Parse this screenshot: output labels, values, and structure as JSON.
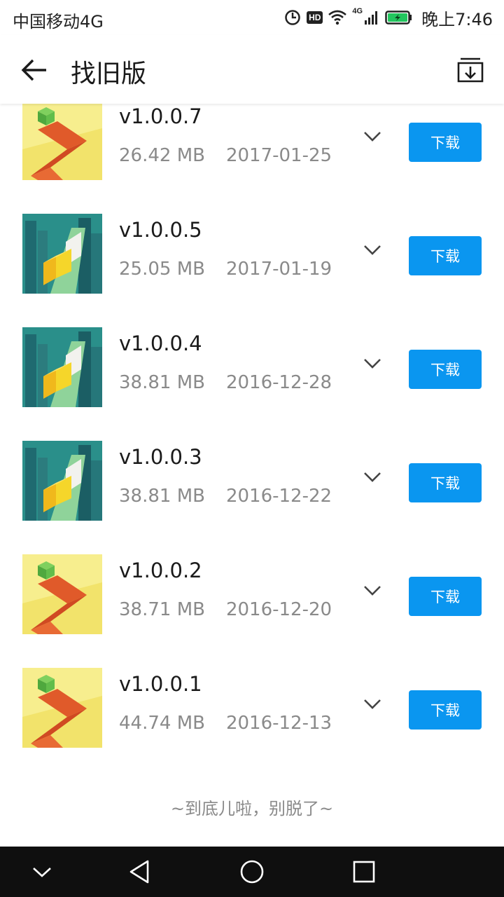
{
  "status_bar": {
    "carrier": "中国移动4G",
    "hd": "HD",
    "network": "4G",
    "time": "晚上7:46",
    "battery_color": "#22c55e"
  },
  "app_bar": {
    "title": "找旧版",
    "back_icon": "arrow-left-icon",
    "download_manager_icon": "download-tray-icon"
  },
  "versions": [
    {
      "version": "v1.0.0.7",
      "size": "26.42 MB",
      "date": "2017-01-25",
      "icon_theme": "yellow-zigzag",
      "download_label": "下载"
    },
    {
      "version": "v1.0.0.5",
      "size": "25.05 MB",
      "date": "2017-01-19",
      "icon_theme": "city-tower",
      "download_label": "下载"
    },
    {
      "version": "v1.0.0.4",
      "size": "38.81 MB",
      "date": "2016-12-28",
      "icon_theme": "city-tower",
      "download_label": "下载"
    },
    {
      "version": "v1.0.0.3",
      "size": "38.81 MB",
      "date": "2016-12-22",
      "icon_theme": "city-tower",
      "download_label": "下载"
    },
    {
      "version": "v1.0.0.2",
      "size": "38.71 MB",
      "date": "2016-12-20",
      "icon_theme": "yellow-zigzag",
      "download_label": "下载"
    },
    {
      "version": "v1.0.0.1",
      "size": "44.74 MB",
      "date": "2016-12-13",
      "icon_theme": "yellow-zigzag",
      "download_label": "下载"
    }
  ],
  "end_of_list": "~到底儿啦，别脱了~",
  "colors": {
    "accent": "#0a96f0",
    "secondary_text": "#8a8a8a"
  }
}
